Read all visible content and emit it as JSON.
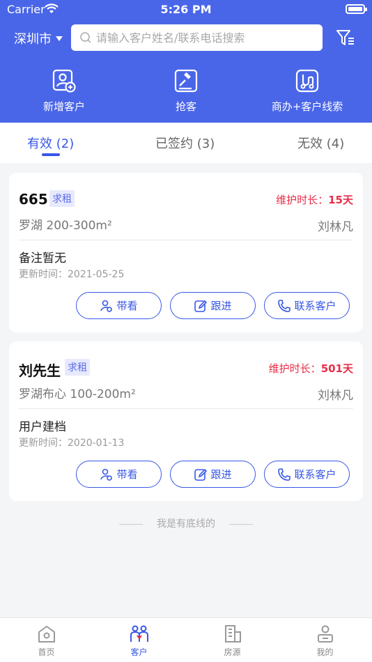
{
  "status": {
    "carrier": "Carrier",
    "time": "5:26 PM"
  },
  "header": {
    "city": "深圳市",
    "search_placeholder": "请输入客户姓名/联系电话搜索",
    "actions": [
      "新增客户",
      "抢客",
      "商办+客户线索"
    ]
  },
  "tabs": [
    "有效 (2)",
    "已签约 (3)",
    "无效 (4)"
  ],
  "cards": [
    {
      "name": "665",
      "tag": "求租",
      "maint_label": "维护时长：",
      "maint_value": "15天",
      "area": "罗湖  200-300m²",
      "agent": "刘林凡",
      "note": "备注暂无",
      "updated": "更新时间：2021-05-25"
    },
    {
      "name": "刘先生",
      "tag": "求租",
      "maint_label": "维护时长：",
      "maint_value": "501天",
      "area": "罗湖布心  100-200m²",
      "agent": "刘林凡",
      "note": "用户建档",
      "updated": "更新时间：2020-01-13"
    }
  ],
  "buttons": {
    "view": "带看",
    "follow": "跟进",
    "contact": "联系客户"
  },
  "footer_text": "我是有底线的",
  "tabbar": [
    "首页",
    "客户",
    "房源",
    "我的"
  ],
  "colors": {
    "primary": "#4a66e8",
    "accent": "#3857e6",
    "alert": "#ea2d48"
  }
}
